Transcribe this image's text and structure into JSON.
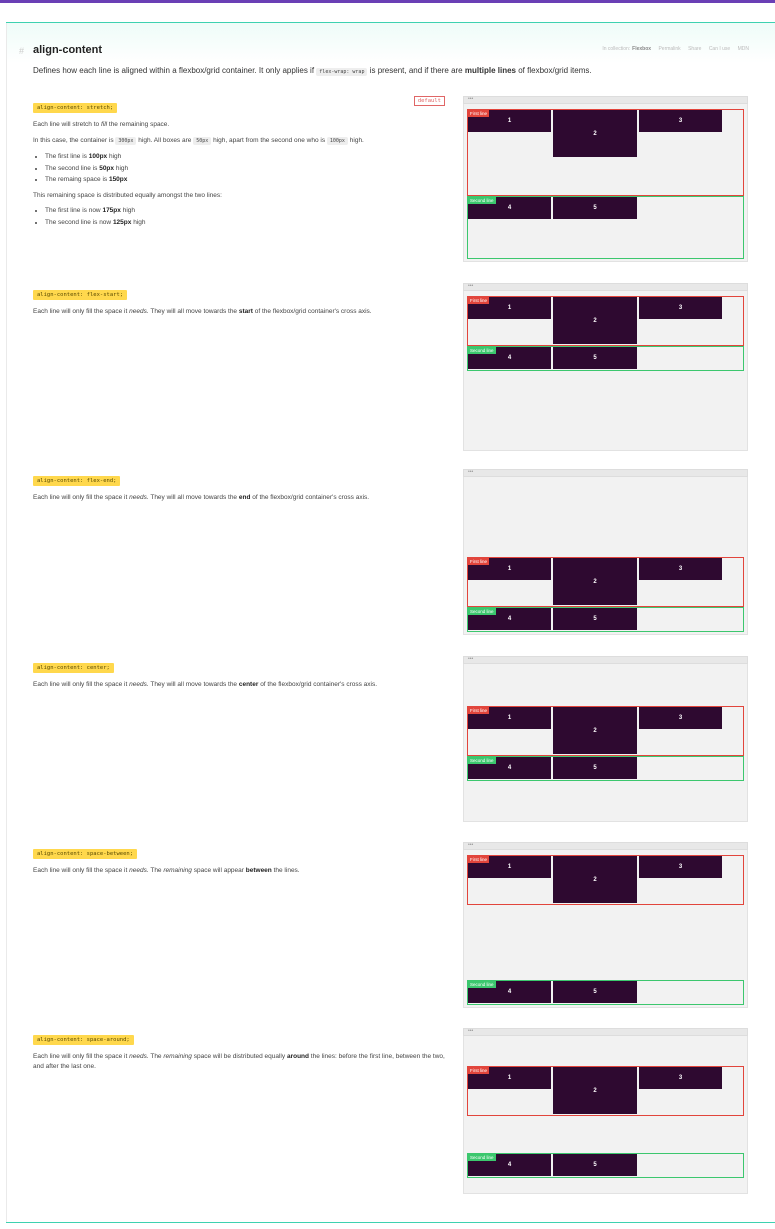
{
  "header": {
    "title": "align-content",
    "links": [
      {
        "label": "In collection:"
      },
      {
        "label": "Flexbox"
      },
      {
        "label": "Permalink"
      },
      {
        "label": "Share"
      },
      {
        "label": "Can I use"
      },
      {
        "label": "MDN"
      }
    ],
    "lede_pre": "Defines how each line is aligned within a flexbox/grid container. It only applies if",
    "lede_code": "flex-wrap: wrap",
    "lede_mid": "is present, and if there are",
    "lede_bold": "multiple lines",
    "lede_post": "of flexbox/grid items."
  },
  "labels": {
    "first_line": "First line",
    "second_line": "Second line",
    "dots": "•••"
  },
  "items": [
    "1",
    "2",
    "3",
    "4",
    "5"
  ],
  "sections": {
    "stretch": {
      "pill": "align-content: stretch;",
      "badge": "default",
      "p1_pre": "Each line will stretch to",
      "p1_em": "fill",
      "p1_post": "the remaining space.",
      "p2_a": "In this case, the container is",
      "p2_code1": "300px",
      "p2_b": "high. All boxes are",
      "p2_code2": "50px",
      "p2_c": "high, apart from the second one who is",
      "p2_code3": "100px",
      "p2_d": "high.",
      "li1_pre": "The first line is",
      "li1_b": "100px",
      "li1_post": "high",
      "li2_pre": "The second line is",
      "li2_b": "50px",
      "li2_post": "high",
      "li3_pre": "The remaing space is",
      "li3_b": "150px",
      "p3": "This remaining space is distributed equally amongst the two lines:",
      "li4_pre": "The first line is now",
      "li4_b": "175px",
      "li4_post": "high",
      "li5_pre": "The second line is now",
      "li5_b": "125px",
      "li5_post": "high"
    },
    "flex_start": {
      "pill": "align-content: flex-start;",
      "t_pre": "Each line will only fill the space it",
      "t_em": "needs.",
      "t_mid": "They will all move towards the",
      "t_b": "start",
      "t_post": "of the flexbox/grid container's cross axis."
    },
    "flex_end": {
      "pill": "align-content: flex-end;",
      "t_pre": "Each line will only fill the space it",
      "t_em": "needs.",
      "t_mid": "They will all move towards the",
      "t_b": "end",
      "t_post": "of the flexbox/grid container's cross axis."
    },
    "center": {
      "pill": "align-content: center;",
      "t_pre": "Each line will only fill the space it",
      "t_em": "needs.",
      "t_mid": "They will all move towards the",
      "t_b": "center",
      "t_post": "of the flexbox/grid container's cross axis."
    },
    "space_between": {
      "pill": "align-content: space-between;",
      "t_pre": "Each line will only fill the space it",
      "t_em": "needs.",
      "t_mid": "The",
      "t_em2": "remaining",
      "t_mid2": "space will appear",
      "t_b": "between",
      "t_post": "the lines."
    },
    "space_around": {
      "pill": "align-content: space-around;",
      "t_pre": "Each line will only fill the space it",
      "t_em": "needs.",
      "t_mid": "The",
      "t_em2": "remaining",
      "t_mid2": "space will be distributed equally",
      "t_b": "around",
      "t_post": "the lines: before the first line, between the two, and after the last one."
    }
  },
  "colors": {
    "first_line": "#e2453c",
    "second_line": "#3cc76e",
    "item": "#2e0930",
    "pill": "#ffd84d",
    "accent": "#3ed1b0"
  }
}
